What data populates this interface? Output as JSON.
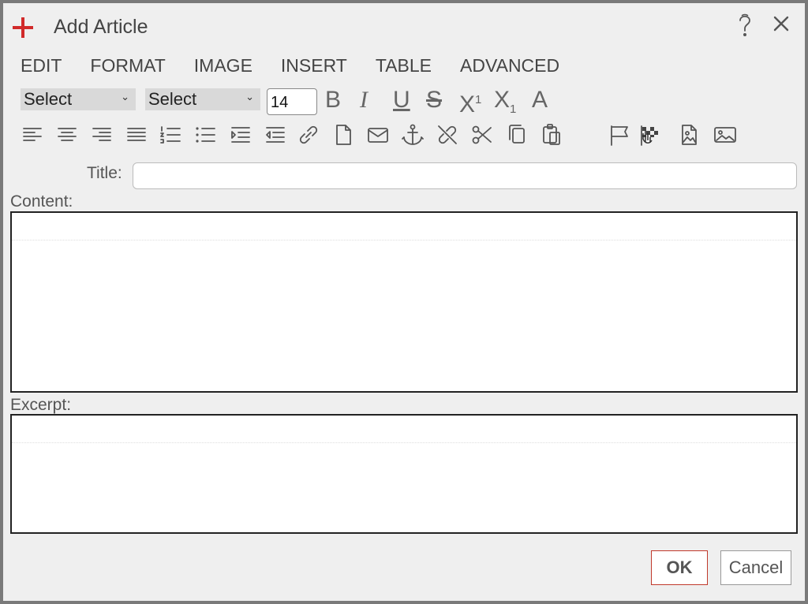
{
  "dialog": {
    "title": "Add Article",
    "accent_color": "#d12a2a"
  },
  "menu": {
    "items": [
      {
        "label": "EDIT"
      },
      {
        "label": "FORMAT"
      },
      {
        "label": "IMAGE"
      },
      {
        "label": "INSERT"
      },
      {
        "label": "TABLE"
      },
      {
        "label": "ADVANCED"
      }
    ]
  },
  "toolbar": {
    "font_select": "Select",
    "style_select": "Select",
    "font_size": "14",
    "bold": "B",
    "italic": "I",
    "underline": "U",
    "strike": "S",
    "superscript_base": "X",
    "superscript_mark": "1",
    "subscript_base": "X",
    "subscript_mark": "1",
    "font_color": "A",
    "icons": [
      "align-left-icon",
      "align-center-icon",
      "align-right-icon",
      "justify-icon",
      "ordered-list-icon",
      "unordered-list-icon",
      "indent-icon",
      "outdent-icon",
      "link-icon",
      "document-icon",
      "email-icon",
      "anchor-icon",
      "unlink-icon",
      "cut-icon",
      "copy-icon",
      "paste-icon",
      "flag-icon",
      "checkered-flag-icon",
      "image-file-icon",
      "image-icon"
    ]
  },
  "form": {
    "title_label": "Title:",
    "title_value": "",
    "content_label": "Content:",
    "excerpt_label": "Excerpt:"
  },
  "buttons": {
    "ok": "OK",
    "cancel": "Cancel"
  }
}
